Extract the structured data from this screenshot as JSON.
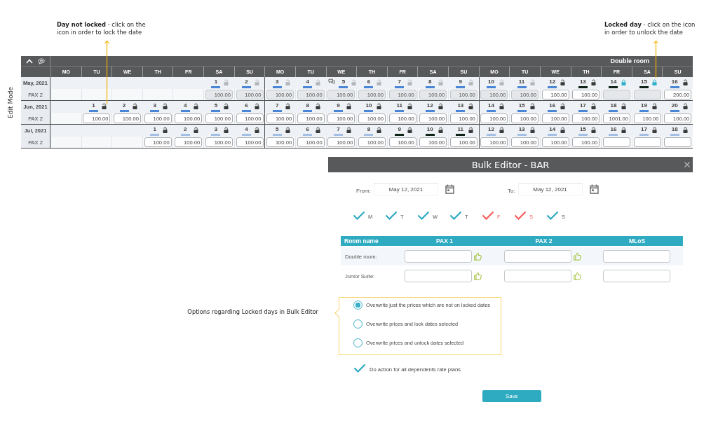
{
  "annotations": [
    {
      "text": "**Day not locked** - click on the icon in order to lock the date"
    },
    {
      "text": "**Locked day** - click on the icon in order to unlock the date"
    }
  ],
  "mode_label": "Edit Mode",
  "calendar": {
    "title": "Double room",
    "weekdays": [
      "MO",
      "TU",
      "WE",
      "TH",
      "FR",
      "SA",
      "SU",
      "MO",
      "TU",
      "WE",
      "TH",
      "FR",
      "SA",
      "SU",
      "MO",
      "TU",
      "WE",
      "TH",
      "FR",
      "SA",
      "SU"
    ],
    "months": [
      {
        "label": "May, 2021",
        "rate_label": "PAX 2",
        "cells": [
          {
            "kind": "empty"
          },
          {
            "kind": "empty"
          },
          {
            "kind": "empty"
          },
          {
            "kind": "empty"
          },
          {
            "kind": "empty"
          },
          {
            "kind": "day",
            "day": "1",
            "locked": false,
            "disabled": true,
            "comment": false,
            "color": "#4a86d6",
            "value": "100.00"
          },
          {
            "kind": "day",
            "day": "2",
            "locked": false,
            "disabled": true,
            "comment": false,
            "color": "#4a86d6",
            "value": "100.00"
          },
          {
            "kind": "day",
            "day": "3",
            "locked": false,
            "disabled": true,
            "comment": false,
            "color": "#4a86d6",
            "value": "100.00"
          },
          {
            "kind": "day",
            "day": "4",
            "locked": false,
            "disabled": true,
            "comment": false,
            "color": "#4a86d6",
            "value": "100.00"
          },
          {
            "kind": "day",
            "day": "5",
            "locked": false,
            "disabled": true,
            "comment": true,
            "color": "#4a86d6",
            "value": "100.00"
          },
          {
            "kind": "day",
            "day": "6",
            "locked": false,
            "disabled": true,
            "comment": false,
            "color": "#4a86d6",
            "value": "100.00"
          },
          {
            "kind": "day",
            "day": "7",
            "locked": false,
            "disabled": true,
            "comment": false,
            "color": "#4a86d6",
            "value": "100.00"
          },
          {
            "kind": "day",
            "day": "8",
            "locked": false,
            "disabled": true,
            "comment": false,
            "color": "#4a86d6",
            "value": "100.00"
          },
          {
            "kind": "day",
            "day": "9",
            "locked": false,
            "disabled": true,
            "comment": false,
            "color": "#4a86d6",
            "value": "100.00"
          },
          {
            "kind": "day",
            "day": "10",
            "locked": false,
            "disabled": true,
            "comment": false,
            "color": "#4a86d6",
            "value": "100.00"
          },
          {
            "kind": "day",
            "day": "11",
            "locked": false,
            "disabled": true,
            "comment": false,
            "color": "#4a86d6",
            "value": "100.00"
          },
          {
            "kind": "day",
            "day": "12",
            "locked": false,
            "disabled": false,
            "comment": false,
            "color": "#4a86d6",
            "value": "100.00"
          },
          {
            "kind": "day",
            "day": "13",
            "locked": false,
            "disabled": false,
            "comment": false,
            "color": "#0f2418",
            "value": "100.00"
          },
          {
            "kind": "day",
            "day": "14",
            "locked": true,
            "disabled": true,
            "comment": false,
            "color": "#0f2418"
          },
          {
            "kind": "day",
            "day": "15",
            "locked": true,
            "disabled": true,
            "comment": false,
            "color": "#0f2418"
          },
          {
            "kind": "day",
            "day": "16",
            "locked": false,
            "disabled": false,
            "comment": false,
            "color": "#4a86d6",
            "value": "200.00"
          }
        ]
      },
      {
        "label": "Jun, 2021",
        "rate_label": "PAX 2",
        "cells": [
          {
            "kind": "empty"
          },
          {
            "kind": "day",
            "day": "1",
            "locked": false,
            "disabled": false,
            "comment": false,
            "color": "#4a86d6",
            "value": "100.00"
          },
          {
            "kind": "day",
            "day": "2",
            "locked": false,
            "disabled": false,
            "comment": false,
            "color": "#4a86d6",
            "value": "100.00"
          },
          {
            "kind": "day",
            "day": "3",
            "locked": false,
            "disabled": false,
            "comment": false,
            "color": "#4a86d6",
            "value": "100.00"
          },
          {
            "kind": "day",
            "day": "4",
            "locked": false,
            "disabled": false,
            "comment": false,
            "color": "#4a86d6",
            "value": "100.00"
          },
          {
            "kind": "day",
            "day": "5",
            "locked": false,
            "disabled": false,
            "comment": false,
            "color": "#4a86d6",
            "value": "100.00"
          },
          {
            "kind": "day",
            "day": "6",
            "locked": false,
            "disabled": false,
            "comment": false,
            "color": "#4a86d6",
            "value": "100.00"
          },
          {
            "kind": "day",
            "day": "7",
            "locked": false,
            "disabled": false,
            "comment": false,
            "color": "#4a86d6",
            "value": "100.00"
          },
          {
            "kind": "day",
            "day": "8",
            "locked": false,
            "disabled": false,
            "comment": false,
            "color": "#4a86d6",
            "value": "100.00"
          },
          {
            "kind": "day",
            "day": "9",
            "locked": false,
            "disabled": false,
            "comment": false,
            "color": "#4a86d6",
            "value": "100.00"
          },
          {
            "kind": "day",
            "day": "10",
            "locked": false,
            "disabled": false,
            "comment": false,
            "color": "#4a86d6",
            "value": "100.00"
          },
          {
            "kind": "day",
            "day": "11",
            "locked": false,
            "disabled": false,
            "comment": false,
            "color": "#4a86d6",
            "value": "100.00"
          },
          {
            "kind": "day",
            "day": "12",
            "locked": false,
            "disabled": false,
            "comment": false,
            "color": "#4a86d6",
            "value": "100.00"
          },
          {
            "kind": "day",
            "day": "13",
            "locked": false,
            "disabled": false,
            "comment": false,
            "color": "#4a86d6",
            "value": "100.00"
          },
          {
            "kind": "day",
            "day": "14",
            "locked": false,
            "disabled": false,
            "comment": false,
            "color": "#4a86d6",
            "value": "100.00"
          },
          {
            "kind": "day",
            "day": "15",
            "locked": false,
            "disabled": false,
            "comment": false,
            "color": "#4a86d6",
            "value": "100.00"
          },
          {
            "kind": "day",
            "day": "16",
            "locked": false,
            "disabled": false,
            "comment": false,
            "color": "#4a86d6",
            "value": "100.00"
          },
          {
            "kind": "day",
            "day": "17",
            "locked": false,
            "disabled": false,
            "comment": false,
            "color": "#4a86d6",
            "value": "100.00"
          },
          {
            "kind": "day",
            "day": "18",
            "locked": false,
            "disabled": false,
            "comment": false,
            "color": "#4a86d6",
            "value": "1001.00"
          },
          {
            "kind": "day",
            "day": "19",
            "locked": false,
            "disabled": false,
            "comment": false,
            "color": "#4a86d6",
            "value": "100.00"
          },
          {
            "kind": "day",
            "day": "20",
            "locked": false,
            "disabled": false,
            "comment": false,
            "color": "#4a86d6",
            "value": "100.00"
          }
        ]
      },
      {
        "label": "Jul, 2021",
        "rate_label": "PAX 2",
        "cells": [
          {
            "kind": "empty"
          },
          {
            "kind": "empty"
          },
          {
            "kind": "empty"
          },
          {
            "kind": "day",
            "day": "1",
            "locked": false,
            "disabled": false,
            "comment": false,
            "color": "#a3bfe6",
            "value": "100.00"
          },
          {
            "kind": "day",
            "day": "2",
            "locked": false,
            "disabled": false,
            "comment": false,
            "color": "#a3bfe6",
            "value": "100.00"
          },
          {
            "kind": "day",
            "day": "3",
            "locked": false,
            "disabled": false,
            "comment": false,
            "color": "#a3bfe6",
            "value": "100.00"
          },
          {
            "kind": "day",
            "day": "4",
            "locked": false,
            "disabled": false,
            "comment": false,
            "color": "#a3bfe6",
            "value": "100.00"
          },
          {
            "kind": "day",
            "day": "5",
            "locked": false,
            "disabled": false,
            "comment": false,
            "color": "#a3bfe6",
            "value": "100.00"
          },
          {
            "kind": "day",
            "day": "6",
            "locked": false,
            "disabled": false,
            "comment": false,
            "color": "#a3bfe6",
            "value": "100.00"
          },
          {
            "kind": "day",
            "day": "7",
            "locked": false,
            "disabled": false,
            "comment": false,
            "color": "#a3bfe6",
            "value": "100.00"
          },
          {
            "kind": "day",
            "day": "8",
            "locked": false,
            "disabled": false,
            "comment": false,
            "color": "#a3bfe6",
            "value": "100.00"
          },
          {
            "kind": "day",
            "day": "9",
            "locked": false,
            "disabled": false,
            "comment": false,
            "color": "#0f2418",
            "value": "100.00"
          },
          {
            "kind": "day",
            "day": "10",
            "locked": false,
            "disabled": false,
            "comment": false,
            "color": "#0f2418",
            "value": "100.00"
          },
          {
            "kind": "day",
            "day": "11",
            "locked": false,
            "disabled": false,
            "comment": false,
            "color": "#0f2418",
            "value": "100.00"
          },
          {
            "kind": "day",
            "day": "12",
            "locked": false,
            "disabled": false,
            "comment": false,
            "color": "#a3bfe6",
            "value": "100.00"
          },
          {
            "kind": "day",
            "day": "13",
            "locked": false,
            "disabled": false,
            "comment": false,
            "color": "#a3bfe6",
            "value": "100.00"
          },
          {
            "kind": "day",
            "day": "14",
            "locked": false,
            "disabled": false,
            "comment": false,
            "color": "#a3bfe6",
            "value": "100.00"
          },
          {
            "kind": "day",
            "day": "15",
            "locked": false,
            "disabled": false,
            "comment": false,
            "color": "#a3bfe6",
            "value": "100.00"
          },
          {
            "kind": "day",
            "day": "16",
            "locked": false,
            "disabled": false,
            "comment": false,
            "color": "#a3bfe6"
          },
          {
            "kind": "day",
            "day": "17",
            "locked": false,
            "disabled": false,
            "comment": false,
            "color": "#a3bfe6"
          },
          {
            "kind": "day",
            "day": "18",
            "locked": false,
            "disabled": false,
            "comment": false,
            "color": "#a3bfe6"
          }
        ]
      }
    ]
  },
  "side_note": "Options regarding Locked days in Bulk Editor",
  "bulk_editor": {
    "title": "Bulk Editor - BAR",
    "from": {
      "label": "From:",
      "value": "May 12, 2021"
    },
    "to": {
      "label": "To:",
      "value": "May 12, 2021"
    },
    "weekdays": [
      {
        "label": "M",
        "checked": true,
        "color": "#2eaac1"
      },
      {
        "label": "T",
        "checked": true,
        "color": "#2eaac1"
      },
      {
        "label": "W",
        "checked": true,
        "color": "#2eaac1"
      },
      {
        "label": "T",
        "checked": true,
        "color": "#2eaac1"
      },
      {
        "label": "F",
        "checked": true,
        "color": "#f25c5c"
      },
      {
        "label": "S",
        "checked": true,
        "color": "#f25c5c"
      },
      {
        "label": "S",
        "checked": true,
        "color": "#2eaac1"
      }
    ],
    "table": {
      "columns": [
        {
          "label": "Room name",
          "kind": "name"
        },
        {
          "label": "PAX 1",
          "kind": "price"
        },
        {
          "label": "PAX 2",
          "kind": "price"
        },
        {
          "label": "MLoS",
          "kind": "stay"
        }
      ],
      "rows": [
        {
          "name": "Double room:"
        },
        {
          "name": "Junior Suite:"
        }
      ]
    },
    "options": [
      {
        "label": "Overwrite just the prices which are not on locked dates",
        "selected": true
      },
      {
        "label": "Overwrite prices and lock dates selected",
        "selected": false
      },
      {
        "label": "Overwrite prices and unlock dates selected",
        "selected": false
      }
    ],
    "dependents": {
      "label": "Do action for all dependents rate plans",
      "checked": true
    },
    "save": "Save"
  }
}
